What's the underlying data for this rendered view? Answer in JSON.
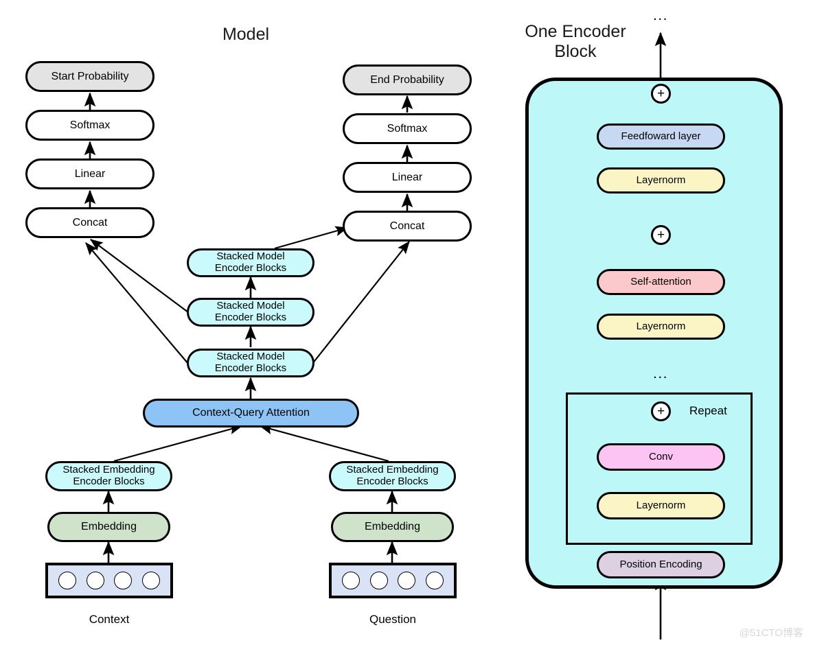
{
  "titles": {
    "model": "Model",
    "encoder_line1": "One Encoder",
    "encoder_line2": "Block"
  },
  "captions": {
    "context": "Context",
    "question": "Question"
  },
  "watermark": "@51CTO博客",
  "symbols": {
    "plus": "+",
    "ellipsis": "...",
    "repeat": "Repeat"
  },
  "model_panel": {
    "start_column": {
      "probability": "Start Probability",
      "softmax": "Softmax",
      "linear": "Linear",
      "concat": "Concat"
    },
    "end_column": {
      "probability": "End Probability",
      "softmax": "Softmax",
      "linear": "Linear",
      "concat": "Concat"
    },
    "stacked_model_encoder_blocks": [
      {
        "line1": "Stacked Model",
        "line2": "Encoder Blocks"
      },
      {
        "line1": "Stacked Model",
        "line2": "Encoder Blocks"
      },
      {
        "line1": "Stacked Model",
        "line2": "Encoder Blocks"
      }
    ],
    "context_query_attention": "Context-Query Attention",
    "context_branch": {
      "stacked_embedding_line1": "Stacked Embedding",
      "stacked_embedding_line2": "Encoder Blocks",
      "embedding": "Embedding",
      "tokens": 4
    },
    "question_branch": {
      "stacked_embedding_line1": "Stacked Embedding",
      "stacked_embedding_line2": "Encoder Blocks",
      "embedding": "Embedding",
      "tokens": 4
    }
  },
  "encoder_panel": {
    "feedforward_layer": "Feedfoward layer",
    "layernorm_top": "Layernorm",
    "self_attention": "Self-attention",
    "layernorm_mid": "Layernorm",
    "conv": "Conv",
    "layernorm_bottom": "Layernorm",
    "position_encoding": "Position Encoding"
  },
  "colors": {
    "grey_fill": "#e3e3e3",
    "white_fill": "#ffffff",
    "cyan_fill": "#cbfafc",
    "container_cyan": "#bdf7f8",
    "blue_fill": "#8ec4f5",
    "green_fill": "#cfe3cb",
    "token_row_fill": "#dae3f6",
    "feedforward_blue": "#c7d8f3",
    "layernorm_yellow": "#fbf4c4",
    "self_attention_pink": "#fbc9cb",
    "conv_magenta": "#fbc4f3",
    "position_encoding_purple": "#ded0e3",
    "stroke": "#000000"
  }
}
